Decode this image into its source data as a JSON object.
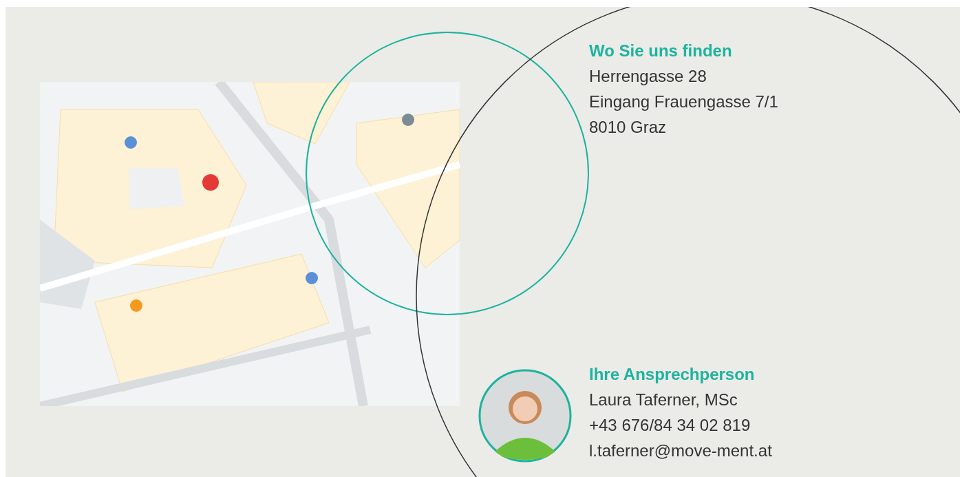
{
  "location": {
    "heading": "Wo Sie uns finden",
    "lines": [
      "Herrengasse 28",
      "Eingang Frauengasse 7/1",
      "8010 Graz"
    ]
  },
  "contact": {
    "heading": "Ihre Ansprechperson",
    "lines": [
      "Laura Taferner, MSc",
      "+43 676/84 34 02 819",
      "l.taferner@move-ment.at"
    ]
  }
}
